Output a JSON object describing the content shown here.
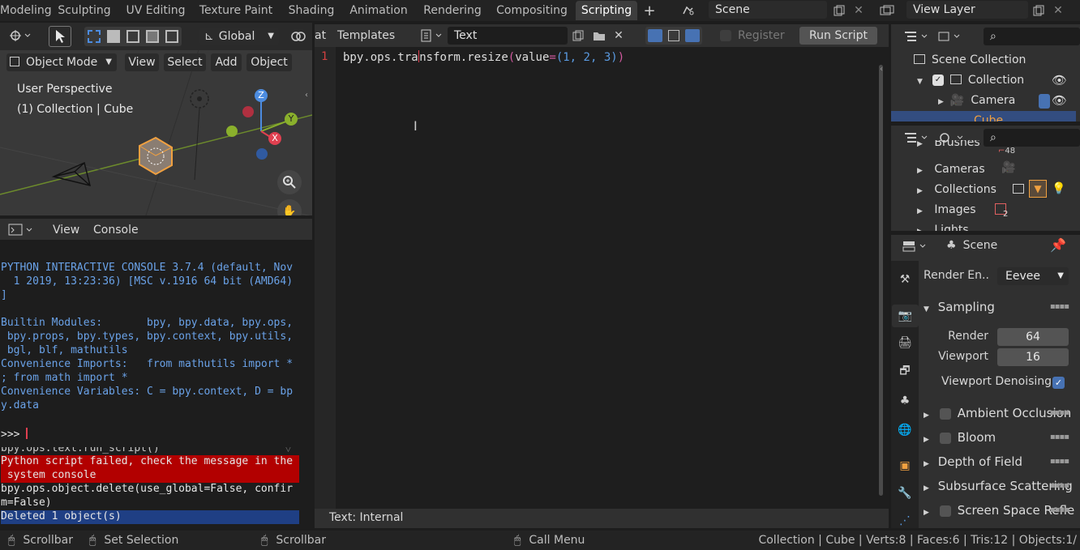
{
  "workspace_tabs": [
    "Modeling",
    "Sculpting",
    "UV Editing",
    "Texture Paint",
    "Shading",
    "Animation",
    "Rendering",
    "Compositing",
    "Scripting"
  ],
  "active_tab": "Scripting",
  "add_tab_label": "+",
  "scene": {
    "name": "Scene",
    "view_layer": "View Layer"
  },
  "viewport": {
    "transform_orientation": "Global",
    "mode": "Object Mode",
    "menus": [
      "View",
      "Select",
      "Add",
      "Object"
    ],
    "perspective_label": "User Perspective",
    "collection_label": "(1) Collection | Cube",
    "axes": {
      "x": "X",
      "y": "Y",
      "z": "Z"
    }
  },
  "console": {
    "menus": [
      "View",
      "Console"
    ],
    "lines": [
      "PYTHON INTERACTIVE CONSOLE 3.7.4 (default, Nov",
      "  1 2019, 13:23:36) [MSC v.1916 64 bit (AMD64)",
      "]",
      "",
      "Builtin Modules:       bpy, bpy.data, bpy.ops,",
      " bpy.props, bpy.types, bpy.context, bpy.utils,",
      " bgl, blf, mathutils",
      "Convenience Imports:   from mathutils import *",
      "; from math import *",
      "Convenience Variables: C = bpy.context, D = bp",
      "y.data"
    ],
    "prompt": ">>> "
  },
  "info": {
    "lines": [
      "bpy.ops.text.run_script()",
      "Python script failed, check the message in the",
      " system console",
      "bpy.ops.object.delete(use_global=False, confir",
      "m=False)",
      "Deleted 1 object(s)"
    ]
  },
  "text_editor": {
    "format_label": "at",
    "templates_label": "Templates",
    "text_name": "Text",
    "register_label": "Register",
    "run_script_label": "Run Script",
    "line_number": "1",
    "code": {
      "a": "bpy.ops.tra",
      "b": "nsform.resize",
      "c": "(",
      "d": "value",
      "e": "=",
      "f": "(1, 2, 3)",
      "g": ")"
    },
    "footer": "Text: Internal"
  },
  "outliner": {
    "scene_collection": "Scene Collection",
    "collection": "Collection",
    "camera": "Camera",
    "cube": "Cube"
  },
  "blend_data": {
    "items": [
      "Brushes",
      "Cameras",
      "Collections",
      "Images",
      "Lights"
    ],
    "brushes_count": "48",
    "images_count": "2"
  },
  "properties": {
    "context": "Scene",
    "render_engine_label": "Render En..",
    "render_engine": "Eevee",
    "sampling": {
      "title": "Sampling",
      "render_label": "Render",
      "render_value": "64",
      "viewport_label": "Viewport",
      "viewport_value": "16",
      "denoise_label": "Viewport Denoising"
    },
    "panels": [
      "Ambient Occlusion",
      "Bloom",
      "Depth of Field",
      "Subsurface Scattering",
      "Screen Space Refle"
    ]
  },
  "statusbar": {
    "left1": "Scrollbar",
    "left2": "Set Selection",
    "mid": "Scrollbar",
    "call": "Call Menu",
    "stats": "Collection | Cube | Verts:8 | Faces:6 | Tris:12 | Objects:1/"
  },
  "colors": {
    "accent_blue": "#4772b3",
    "error_red": "#b20000",
    "console_blue": "#6aa2e8",
    "cube_orange": "#f0a040"
  }
}
